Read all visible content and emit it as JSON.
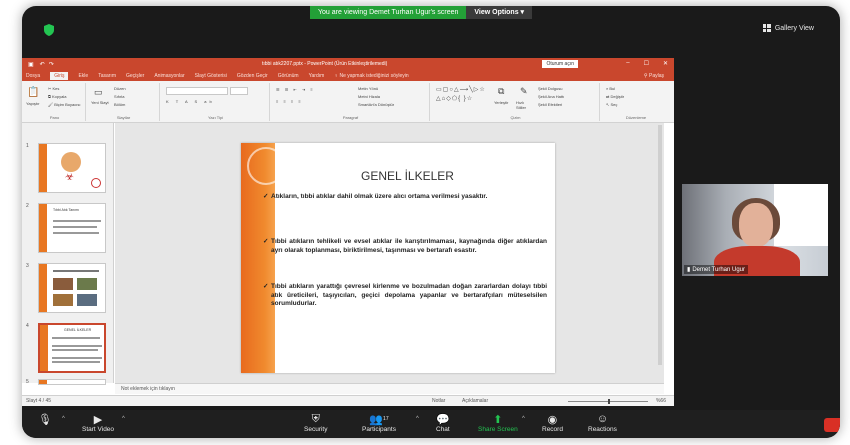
{
  "zoom": {
    "share_banner": "You are viewing Demet Turhan Ugur's screen",
    "view_options": "View Options",
    "gallery_view": "Gallery View",
    "participant_name": "Demet Turhan Ugur",
    "participant_count": "17",
    "toolbar": {
      "start_video": "Start Video",
      "security": "Security",
      "participants": "Participants",
      "chat": "Chat",
      "share_screen": "Share Screen",
      "record": "Record",
      "reactions": "Reactions"
    },
    "colors": {
      "share_green": "#23a037",
      "end_red": "#d93025",
      "share_screen_green": "#23c552"
    }
  },
  "ppt": {
    "window_title": "tıbbi atık2207.pptx - PowerPoint (Ürün Etkinleştirilemedi)",
    "sign_in": "Oturum açın",
    "tabs": [
      "Dosya",
      "Giriş",
      "Ekle",
      "Tasarım",
      "Geçişler",
      "Animasyonlar",
      "Slayt Gösterisi",
      "Gözden Geçir",
      "Görünüm",
      "Yardım",
      "Ne yapmak istediğinizi söyleyin"
    ],
    "active_tab": "Giriş",
    "share": "Paylaş",
    "ribbon": {
      "clipboard": {
        "paste": "Yapıştır",
        "cut": "Kes",
        "copy": "Kopyala",
        "format_painter": "Biçim Boyacısı",
        "label": "Pano"
      },
      "slides": {
        "new_slide": "Yeni Slayt",
        "layout": "Düzen",
        "reset": "Sıfırla",
        "section": "Bölüm",
        "label": "Slaytlar"
      },
      "font": {
        "label": "Yazı Tipi"
      },
      "paragraph": {
        "text_direction": "Metin Yönü",
        "align_text": "Metni Hizala",
        "smartart": "SmartArt'a Dönüştür",
        "label": "Paragraf"
      },
      "drawing": {
        "arrange": "Yerleştir",
        "quick_styles": "Hızlı Stiller",
        "shape_fill": "Şekil Dolgusu",
        "shape_outline": "Şekil Ana Hattı",
        "shape_effects": "Şekil Efektleri",
        "label": "Çizim"
      },
      "editing": {
        "find": "Bul",
        "replace": "Değiştir",
        "select": "Seç",
        "label": "Düzenleme"
      }
    },
    "thumbnails": [
      {
        "number": "1"
      },
      {
        "number": "2",
        "title": "Tıbbi Atık Tanımı"
      },
      {
        "number": "3"
      },
      {
        "number": "4",
        "title": "GENEL İLKELER"
      },
      {
        "number": "5"
      }
    ],
    "selected_slide": 4,
    "slide": {
      "title": "GENEL İLKELER",
      "bullets": [
        "Atıkların, tıbbi atıklar dahil olmak üzere alıcı ortama verilmesi yasaktır.",
        "Tıbbi atıkların tehlikeli ve evsel atıklar ile karıştırılmaması, kaynağında diğer atıklardan ayrı olarak toplanması, biriktirilmesi, taşınması ve bertarafı esastır.",
        "Tıbbi atıkların yarattığı çevresel kirlenme ve bozulmadan doğan zararlardan dolayı tıbbi atık üreticileri, taşıyıcıları, geçici depolama yapanlar ve bertarafçıları müteselsilen sorumludurlar."
      ]
    },
    "notes_placeholder": "Not eklemek için tıklayın",
    "status": {
      "slide_counter": "Slayt 4 / 45",
      "notes": "Notlar",
      "comments": "Açıklamalar",
      "zoom": "%66"
    },
    "colors": {
      "accent": "#c9472d",
      "slide_band": "#e86a1e"
    }
  }
}
